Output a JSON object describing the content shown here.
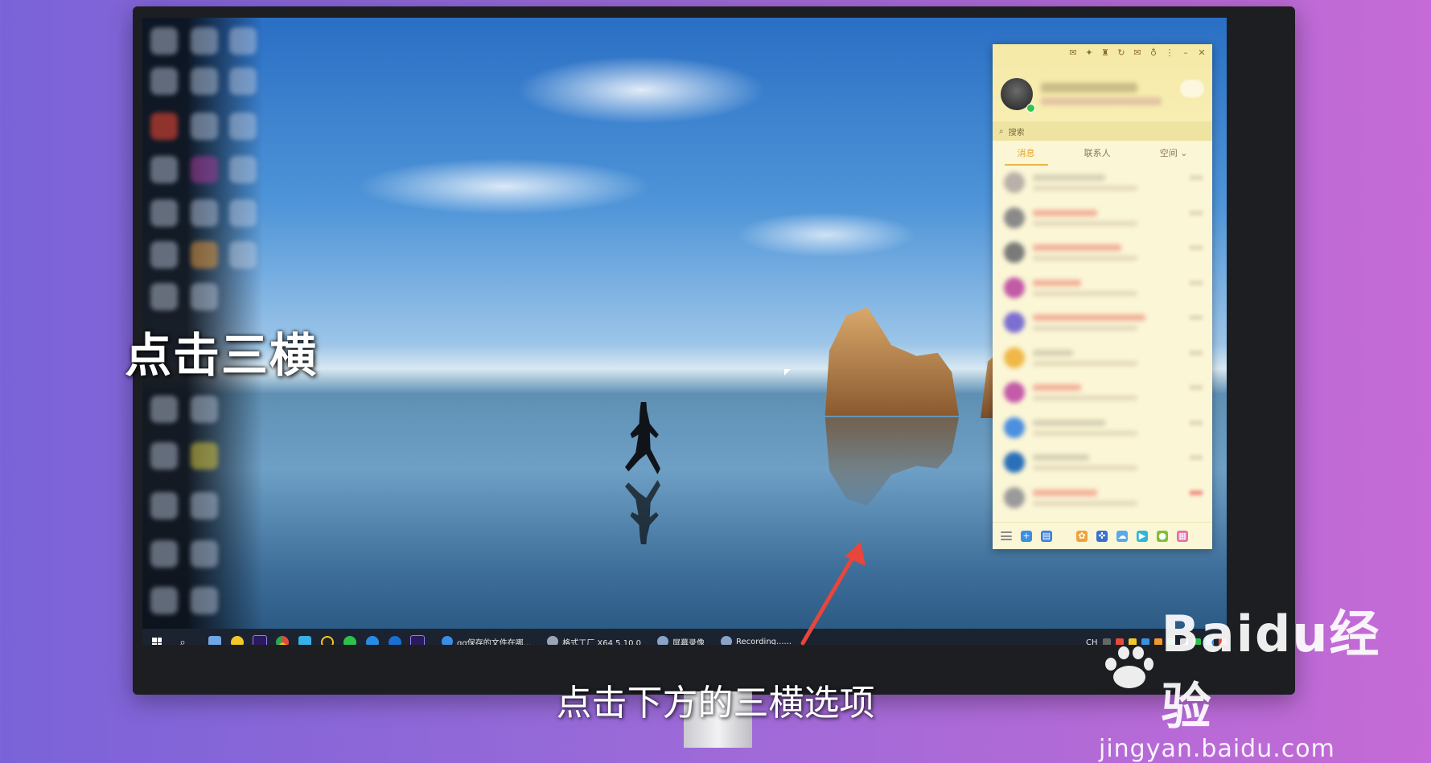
{
  "overlay": {
    "caption_left": "点击三横",
    "subtitle": "点击下方的三横选项",
    "arrow_color": "#e8463a"
  },
  "watermark": {
    "brand": "Baidu经验",
    "url": "jingyan.baidu.com"
  },
  "qq": {
    "search_placeholder": "搜索",
    "tabs": [
      {
        "label": "消息",
        "active": true
      },
      {
        "label": "联系人",
        "active": false
      },
      {
        "label": "空间",
        "active": false
      }
    ],
    "bottom_icons": [
      "menu-icon",
      "add-contact-icon",
      "file-icon",
      "game-icon",
      "gamepad-icon",
      "cloud-icon",
      "video-icon",
      "sports-icon",
      "apps-grid-icon"
    ],
    "accent_color": "#e9b64a"
  },
  "taskbar": {
    "apps": [
      {
        "label": "qq保存的文件在哪..."
      },
      {
        "label": "格式工厂 X64 5.10.0"
      },
      {
        "label": "屏幕录像"
      },
      {
        "label": "Recording......"
      }
    ],
    "tray_lang": "CH"
  }
}
